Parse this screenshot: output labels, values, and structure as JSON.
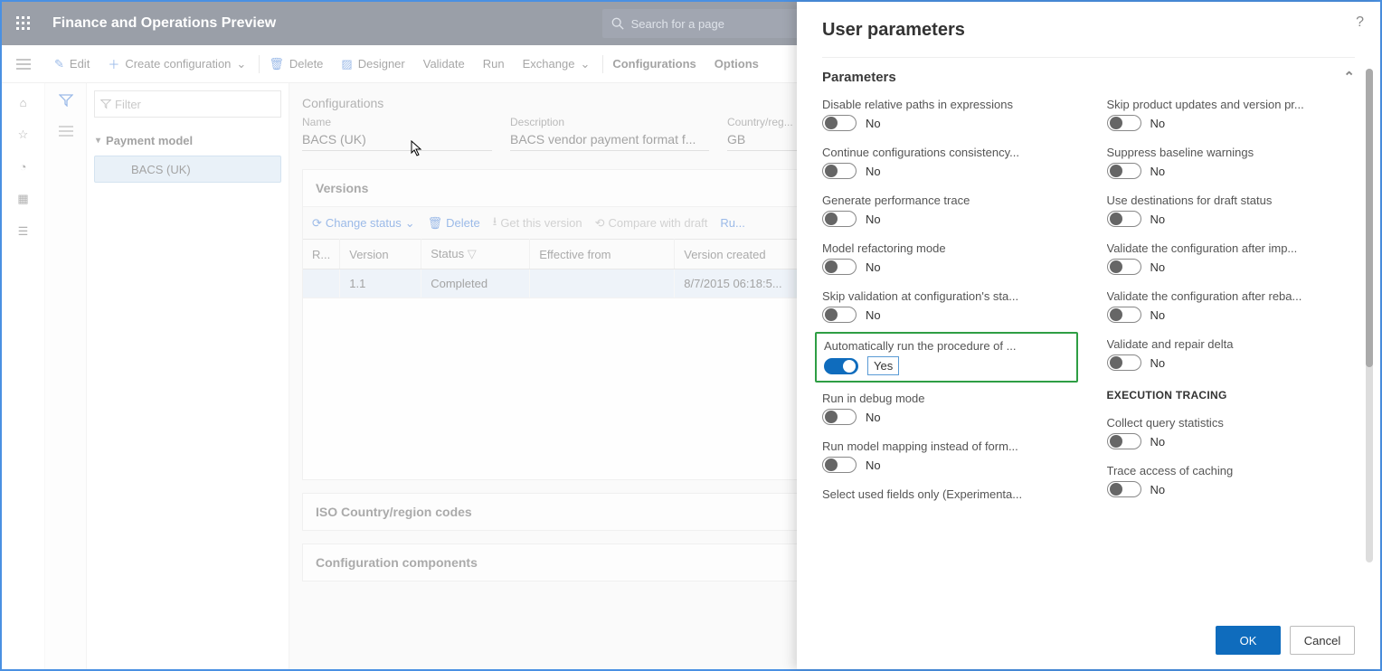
{
  "app_title": "Finance and Operations Preview",
  "search_placeholder": "Search for a page",
  "cmdbar": {
    "edit": "Edit",
    "create": "Create configuration",
    "delete": "Delete",
    "designer": "Designer",
    "validate": "Validate",
    "run": "Run",
    "exchange": "Exchange",
    "configurations": "Configurations",
    "options": "Options"
  },
  "filter_placeholder": "Filter",
  "tree": {
    "root": "Payment model",
    "child": "BACS (UK)"
  },
  "breadcrumb": "Configurations",
  "fields": {
    "name_label": "Name",
    "name_value": "BACS (UK)",
    "desc_label": "Description",
    "desc_value": "BACS vendor payment format f...",
    "country_label": "Country/reg...",
    "country_value": "GB"
  },
  "sections": {
    "versions": "Versions",
    "iso": "ISO Country/region codes",
    "components": "Configuration components"
  },
  "version_cmds": {
    "change": "Change status",
    "delete": "Delete",
    "get": "Get this version",
    "compare": "Compare with draft",
    "run": "Ru..."
  },
  "version_cols": {
    "rebase": "R...",
    "version": "Version",
    "status": "Status",
    "effective": "Effective from",
    "created": "Version created"
  },
  "version_row": {
    "version": "1.1",
    "status": "Completed",
    "effective": "",
    "created": "8/7/2015 06:18:5..."
  },
  "panel": {
    "title": "User parameters",
    "group": "Parameters",
    "left": [
      {
        "label": "Disable relative paths in expressions",
        "on": false,
        "val": "No"
      },
      {
        "label": "Continue configurations consistency...",
        "on": false,
        "val": "No"
      },
      {
        "label": "Generate performance trace",
        "on": false,
        "val": "No"
      },
      {
        "label": "Model refactoring mode",
        "on": false,
        "val": "No"
      },
      {
        "label": "Skip validation at configuration's sta...",
        "on": false,
        "val": "No"
      },
      {
        "label": "Automatically run the procedure of ...",
        "on": true,
        "val": "Yes",
        "highlight": true,
        "boxed": true
      },
      {
        "label": "Run in debug mode",
        "on": false,
        "val": "No"
      },
      {
        "label": "Run model mapping instead of form...",
        "on": false,
        "val": "No"
      },
      {
        "label": "Select used fields only (Experimenta...",
        "on": null,
        "val": ""
      }
    ],
    "right_a": [
      {
        "label": "Skip product updates and version pr...",
        "on": false,
        "val": "No"
      },
      {
        "label": "Suppress baseline warnings",
        "on": false,
        "val": "No"
      },
      {
        "label": "Use destinations for draft status",
        "on": false,
        "val": "No"
      },
      {
        "label": "Validate the configuration after imp...",
        "on": false,
        "val": "No"
      },
      {
        "label": "Validate the configuration after reba...",
        "on": false,
        "val": "No"
      },
      {
        "label": "Validate and repair delta",
        "on": false,
        "val": "No"
      }
    ],
    "right_subhead": "EXECUTION TRACING",
    "right_b": [
      {
        "label": "Collect query statistics",
        "on": false,
        "val": "No"
      },
      {
        "label": "Trace access of caching",
        "on": false,
        "val": "No"
      }
    ],
    "ok": "OK",
    "cancel": "Cancel"
  }
}
